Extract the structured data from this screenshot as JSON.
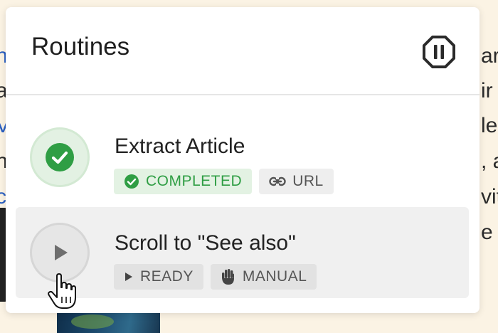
{
  "panel": {
    "title": "Routines",
    "pause_icon": "pause-octagon-icon"
  },
  "routines": [
    {
      "title": "Extract Article",
      "status_icon": "check-circle-icon",
      "chips": [
        {
          "label": "COMPLETED",
          "icon": "check-circle-icon"
        },
        {
          "label": "URL",
          "icon": "link-icon"
        }
      ]
    },
    {
      "title": "Scroll to \"See also\"",
      "status_icon": "play-icon",
      "chips": [
        {
          "label": "READY",
          "icon": "play-icon"
        },
        {
          "label": "MANUAL",
          "icon": "hand-icon"
        }
      ]
    }
  ],
  "background": {
    "left_fragments": [
      "n",
      "a",
      "V",
      "n",
      "c"
    ],
    "right_fragments": [
      "ar",
      "ir",
      "le",
      ", a",
      "vit",
      "e"
    ]
  },
  "colors": {
    "success": "#2f9e44",
    "success_bg": "#e3f2e3",
    "chip_bg": "#eeeeee",
    "page_bg": "#fbf3e4",
    "link": "#2a5fc1"
  },
  "cursor_icon": "hand-pointer-cursor-icon"
}
